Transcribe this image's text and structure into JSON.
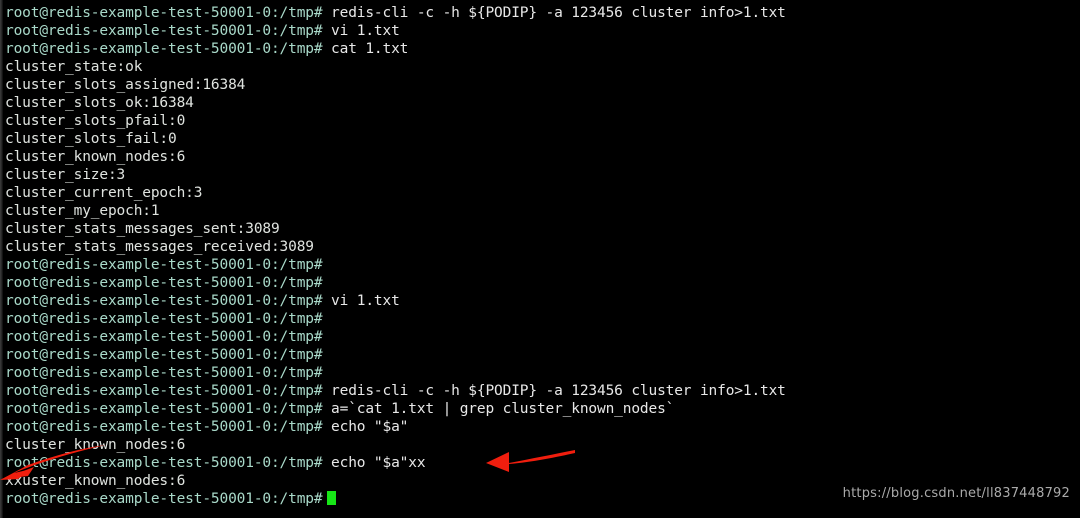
{
  "terminal": {
    "prompt": "root@redis-example-test-50001-0:/tmp#",
    "colors": {
      "background": "#000000",
      "prompt": "#a9d9c9",
      "command": "#e8e8e8",
      "output": "#dfe3df",
      "cursor": "#17e617",
      "annotation": "#f01e0e",
      "watermark": "#b9b9b9"
    },
    "cursor_char": "block-cursor",
    "lines": [
      {
        "type": "command",
        "command": "redis-cli -c -h ${PODIP} -a 123456 cluster info>1.txt"
      },
      {
        "type": "command",
        "command": "vi 1.txt"
      },
      {
        "type": "command",
        "command": "cat 1.txt"
      },
      {
        "type": "output",
        "text": "cluster_state:ok"
      },
      {
        "type": "output",
        "text": "cluster_slots_assigned:16384"
      },
      {
        "type": "output",
        "text": "cluster_slots_ok:16384"
      },
      {
        "type": "output",
        "text": "cluster_slots_pfail:0"
      },
      {
        "type": "output",
        "text": "cluster_slots_fail:0"
      },
      {
        "type": "output",
        "text": "cluster_known_nodes:6"
      },
      {
        "type": "output",
        "text": "cluster_size:3"
      },
      {
        "type": "output",
        "text": "cluster_current_epoch:3"
      },
      {
        "type": "output",
        "text": "cluster_my_epoch:1"
      },
      {
        "type": "output",
        "text": "cluster_stats_messages_sent:3089"
      },
      {
        "type": "output",
        "text": "cluster_stats_messages_received:3089"
      },
      {
        "type": "command",
        "command": ""
      },
      {
        "type": "command",
        "command": ""
      },
      {
        "type": "command",
        "command": "vi 1.txt"
      },
      {
        "type": "command",
        "command": ""
      },
      {
        "type": "command",
        "command": ""
      },
      {
        "type": "command",
        "command": ""
      },
      {
        "type": "command",
        "command": ""
      },
      {
        "type": "command",
        "command": "redis-cli -c -h ${PODIP} -a 123456 cluster info>1.txt"
      },
      {
        "type": "command",
        "command": "a=`cat 1.txt | grep cluster_known_nodes`"
      },
      {
        "type": "command",
        "command": "echo \"$a\""
      },
      {
        "type": "output",
        "text": "cluster_known_nodes:6"
      },
      {
        "type": "command",
        "command": "echo \"$a\"xx"
      },
      {
        "type": "output",
        "text": "xxuster_known_nodes:6"
      },
      {
        "type": "command",
        "command": "",
        "cursor": true
      }
    ]
  },
  "annotations": [
    {
      "name": "arrow-left",
      "shape": "arrow-pointing-down-left"
    },
    {
      "name": "arrow-right",
      "shape": "arrow-pointing-left"
    }
  ],
  "watermark": {
    "text": "https://blog.csdn.net/ll837448792"
  }
}
